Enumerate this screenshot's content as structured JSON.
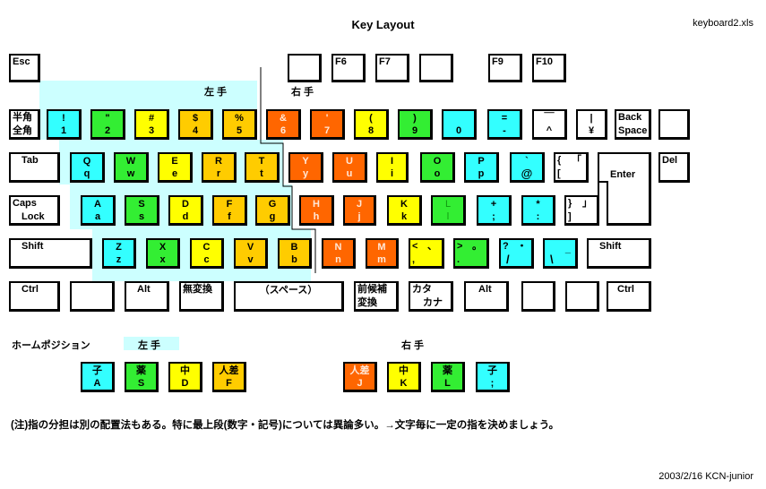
{
  "title": "Key Layout",
  "filename": "keyboard2.xls",
  "labels": {
    "left_hand": "左 手",
    "right_hand": "右 手",
    "home_position": "ホームポジション"
  },
  "colors": {
    "pinky": "#33ffff",
    "ring": "#33ee33",
    "middle": "#ffff00",
    "index_left": "#ffcc00",
    "index_right": "#ff6600",
    "left_zone": "#ccffff"
  },
  "function_row": [
    {
      "label": "Esc"
    },
    {
      "label": ""
    },
    {
      "label": "F6"
    },
    {
      "label": "F7"
    },
    {
      "label": ""
    },
    {
      "label": "F9"
    },
    {
      "label": "F10"
    }
  ],
  "row1": [
    {
      "top": "半角",
      "bottom": "全角"
    },
    {
      "top": "!",
      "bottom": "1"
    },
    {
      "top": "\"",
      "bottom": "2"
    },
    {
      "top": "#",
      "bottom": "3"
    },
    {
      "top": "$",
      "bottom": "4"
    },
    {
      "top": "%",
      "bottom": "5"
    },
    {
      "top": "&",
      "bottom": "6"
    },
    {
      "top": "'",
      "bottom": "7"
    },
    {
      "top": "(",
      "bottom": "8"
    },
    {
      "top": ")",
      "bottom": "9"
    },
    {
      "top": "",
      "bottom": "0"
    },
    {
      "top": "=",
      "bottom": "-"
    },
    {
      "top": "￣",
      "bottom": "^"
    },
    {
      "top": "|",
      "bottom": "¥"
    },
    {
      "top": "Back",
      "bottom": "Space"
    },
    {
      "top": "",
      "bottom": ""
    }
  ],
  "row2": [
    {
      "top": "Tab",
      "bottom": ""
    },
    {
      "top": "Q",
      "bottom": "q"
    },
    {
      "top": "W",
      "bottom": "w"
    },
    {
      "top": "E",
      "bottom": "e"
    },
    {
      "top": "R",
      "bottom": "r"
    },
    {
      "top": "T",
      "bottom": "t"
    },
    {
      "top": "Y",
      "bottom": "y"
    },
    {
      "top": "U",
      "bottom": "u"
    },
    {
      "top": "I",
      "bottom": "i"
    },
    {
      "top": "O",
      "bottom": "o"
    },
    {
      "top": "P",
      "bottom": "p"
    },
    {
      "top": "`",
      "bottom": "@"
    },
    {
      "top": "{",
      "top_right": "「",
      "bottom": "["
    },
    {
      "top": "Enter",
      "bottom": ""
    },
    {
      "top": "Del",
      "bottom": ""
    }
  ],
  "row3": [
    {
      "top": "Caps",
      "bottom": "Lock"
    },
    {
      "top": "A",
      "bottom": "a"
    },
    {
      "top": "S",
      "bottom": "s"
    },
    {
      "top": "D",
      "bottom": "d"
    },
    {
      "top": "F",
      "bottom": "f"
    },
    {
      "top": "G",
      "bottom": "g"
    },
    {
      "top": "H",
      "bottom": "h"
    },
    {
      "top": "J",
      "bottom": "j"
    },
    {
      "top": "K",
      "bottom": "k"
    },
    {
      "top": "L",
      "bottom": "l"
    },
    {
      "top": "+",
      "bottom": ";"
    },
    {
      "top": "*",
      "bottom": ":"
    },
    {
      "top": "}",
      "top_right": "」",
      "bottom": "]"
    }
  ],
  "row4": [
    {
      "top": "Shift",
      "bottom": ""
    },
    {
      "top": "Z",
      "bottom": "z"
    },
    {
      "top": "X",
      "bottom": "x"
    },
    {
      "top": "C",
      "bottom": "c"
    },
    {
      "top": "V",
      "bottom": "v"
    },
    {
      "top": "B",
      "bottom": "b"
    },
    {
      "top": "N",
      "bottom": "n"
    },
    {
      "top": "M",
      "bottom": "m"
    },
    {
      "top": "<",
      "top_right": "、",
      "bottom": ","
    },
    {
      "top": ">",
      "top_right": "。",
      "bottom": "."
    },
    {
      "top": "?",
      "top_right": "・",
      "bottom": "/"
    },
    {
      "top": "",
      "top_right": "_",
      "bottom": "\\"
    },
    {
      "top": "Shift",
      "bottom": ""
    }
  ],
  "row5": [
    {
      "top": "Ctrl",
      "bottom": ""
    },
    {
      "top": "",
      "bottom": ""
    },
    {
      "top": "Alt",
      "bottom": ""
    },
    {
      "top": "無変換",
      "bottom": ""
    },
    {
      "top": "（スペース）",
      "bottom": ""
    },
    {
      "top": "前候補",
      "bottom": "変換"
    },
    {
      "top": "カタ",
      "bottom": "カナ"
    },
    {
      "top": "Alt",
      "bottom": ""
    },
    {
      "top": "",
      "bottom": ""
    },
    {
      "top": "",
      "bottom": ""
    },
    {
      "top": "Ctrl",
      "bottom": ""
    }
  ],
  "home_position": {
    "left": [
      {
        "finger": "子",
        "key": "A"
      },
      {
        "finger": "薬",
        "key": "S"
      },
      {
        "finger": "中",
        "key": "D"
      },
      {
        "finger": "人差",
        "key": "F"
      }
    ],
    "right": [
      {
        "finger": "人差",
        "key": "J"
      },
      {
        "finger": "中",
        "key": "K"
      },
      {
        "finger": "薬",
        "key": "L"
      },
      {
        "finger": "子",
        "key": ";"
      }
    ]
  },
  "note": "(注)指の分担は別の配置法もある。特に最上段(数字・記号)については異論多い。→文字毎に一定の指を決めましょう。",
  "footer": "2003/2/16   KCN-junior"
}
